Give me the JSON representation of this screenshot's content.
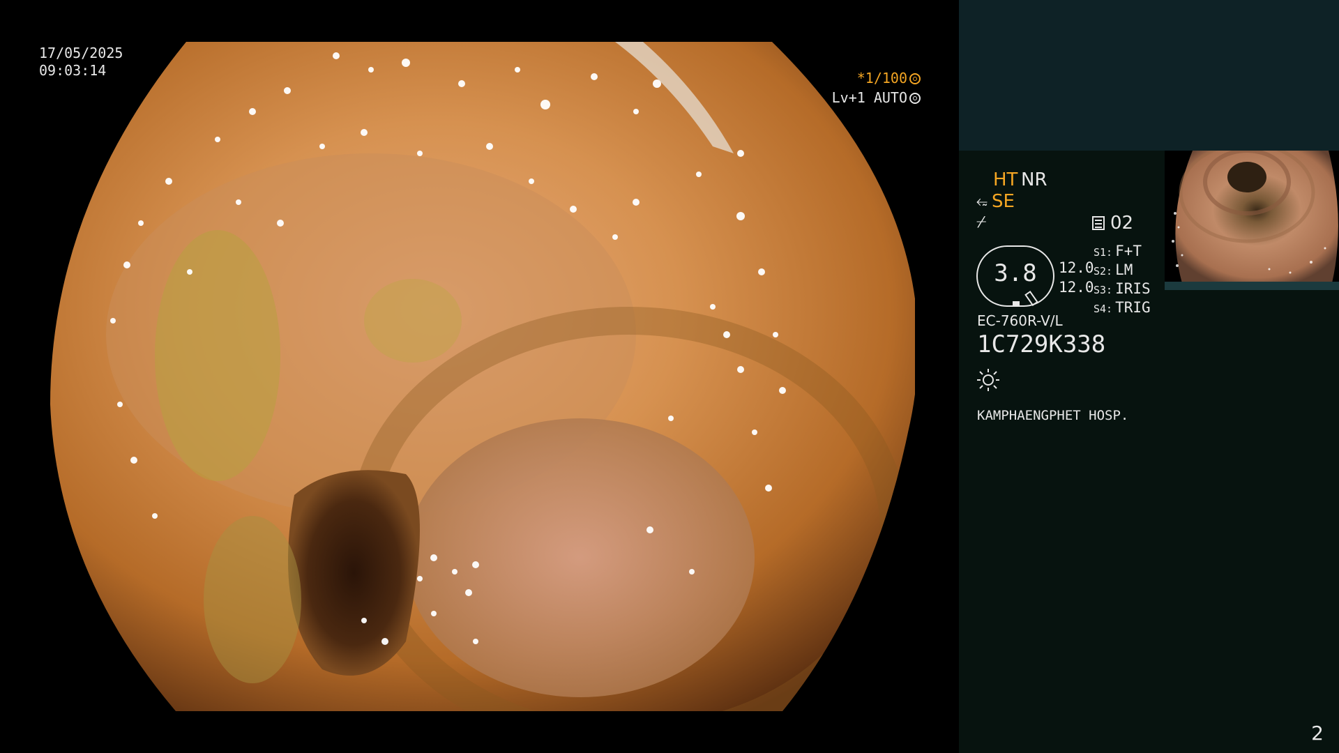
{
  "overlay": {
    "date": "17/05/2025",
    "time": "09:03:14",
    "shutter_label": "*1/100",
    "iris_label": "Lv+1 AUTO"
  },
  "info_panel": {
    "mode_ht": "HT",
    "mode_nr": "NR",
    "mode_se": "SE",
    "memory_number": "02",
    "zoom_value": "3.8",
    "enhance_values": [
      "12.0",
      "12.0"
    ],
    "switches": [
      {
        "key": "S1:",
        "value": "F+T"
      },
      {
        "key": "S2:",
        "value": "LM"
      },
      {
        "key": "S3:",
        "value": "IRIS"
      },
      {
        "key": "S4:",
        "value": "TRIG"
      }
    ],
    "scope_model": "EC-760R-V/L",
    "scope_serial": "1C729K338",
    "hospital": "KAMPHAENGPHET HOSP."
  },
  "footer": {
    "page_number": "2"
  },
  "icons": {
    "shutter": "shutter-icon",
    "iris": "iris-icon",
    "structure_enhance": "se-icon",
    "freeze": "freeze-icon",
    "memory": "memory-icon",
    "light": "light-icon"
  },
  "colors": {
    "accent": "#f5a623",
    "text": "#e8e8e8",
    "panel_top": "#0e2226",
    "panel": "#07130f"
  }
}
